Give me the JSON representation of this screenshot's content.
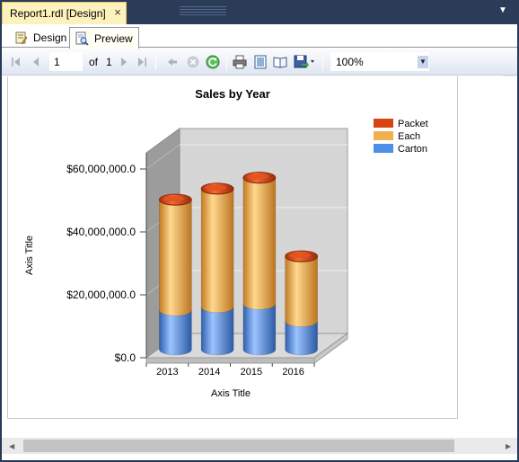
{
  "document_tab": {
    "title": "Report1.rdl [Design]",
    "close_glyph": "×"
  },
  "view_tabs": [
    {
      "label": "Design",
      "icon": "design-icon",
      "selected": false
    },
    {
      "label": "Preview",
      "icon": "preview-icon",
      "selected": true
    }
  ],
  "toolbar": {
    "page_number": "1",
    "of_label": "of",
    "total_pages": "1",
    "zoom": "100%",
    "buttons": [
      "first-page",
      "previous-page",
      "next-page",
      "last-page",
      "back",
      "stop",
      "refresh",
      "print",
      "print-layout",
      "page-setup",
      "export"
    ]
  },
  "colors": {
    "packet": "#d64510",
    "each": "#f0b050",
    "carton": "#4d8fe6",
    "tab_active": "#fdf1bc",
    "chrome_dark": "#2b3c59"
  },
  "chart_data": {
    "type": "bar",
    "stacked": true,
    "style": "3d-cylinder",
    "title": "Sales by Year",
    "xlabel": "Axis Title",
    "ylabel": "Axis Title",
    "categories": [
      "2013",
      "2014",
      "2015",
      "2016"
    ],
    "series": [
      {
        "name": "Carton",
        "values": [
          12500000,
          13500000,
          14500000,
          9000000
        ]
      },
      {
        "name": "Each",
        "values": [
          35000000,
          37500000,
          40000000,
          20500000
        ]
      },
      {
        "name": "Packet",
        "values": [
          200000,
          200000,
          200000,
          200000
        ]
      }
    ],
    "ylim": [
      0,
      70000000
    ],
    "yticks": [
      "$0.0",
      "$20,000,000.0",
      "$40,000,000.0",
      "$60,000,000.0"
    ],
    "ytick_values": [
      0,
      20000000,
      40000000,
      60000000
    ],
    "legend_position": "top-right",
    "grid": true
  }
}
